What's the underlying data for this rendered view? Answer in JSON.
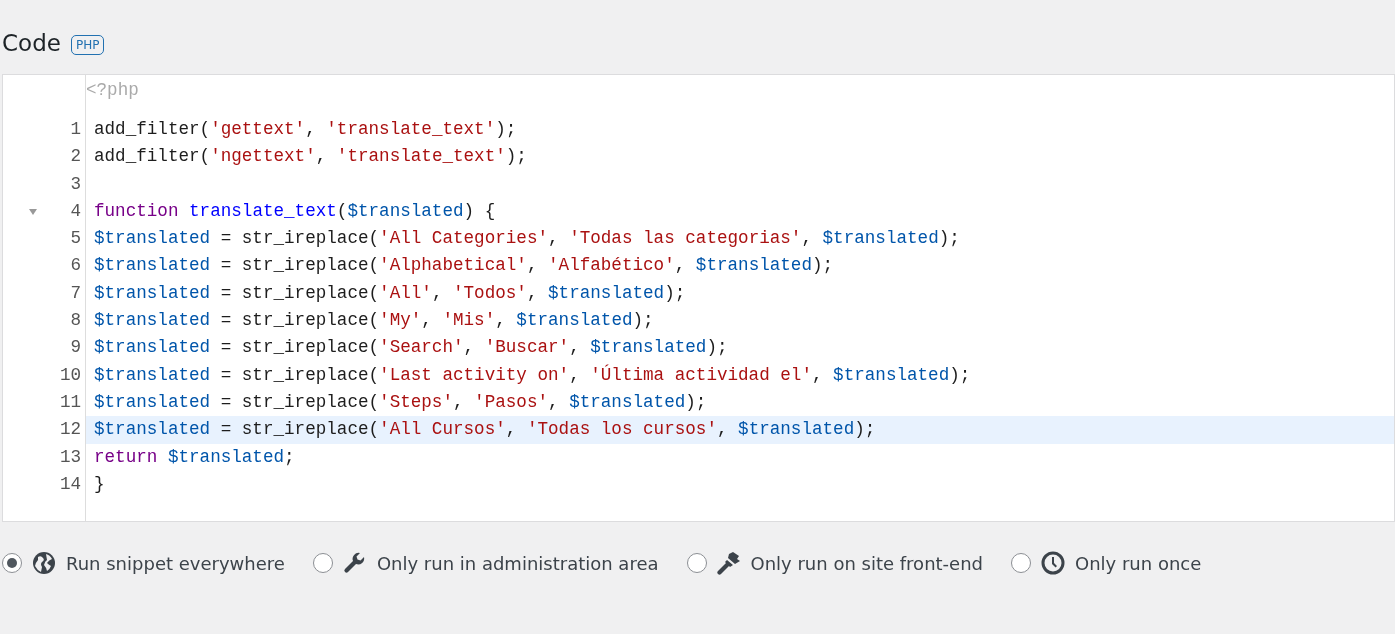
{
  "heading": {
    "title": "Code",
    "badge": "PHP"
  },
  "editor": {
    "preamble": "<?php",
    "lines": [
      {
        "number": "1",
        "active": false,
        "foldable": false,
        "tokens": [
          {
            "kind": "plain",
            "text": "add_filter("
          },
          {
            "kind": "string",
            "text": "'gettext'"
          },
          {
            "kind": "plain",
            "text": ", "
          },
          {
            "kind": "string",
            "text": "'translate_text'"
          },
          {
            "kind": "plain",
            "text": ");"
          }
        ]
      },
      {
        "number": "2",
        "active": false,
        "foldable": false,
        "tokens": [
          {
            "kind": "plain",
            "text": "add_filter("
          },
          {
            "kind": "string",
            "text": "'ngettext'"
          },
          {
            "kind": "plain",
            "text": ", "
          },
          {
            "kind": "string",
            "text": "'translate_text'"
          },
          {
            "kind": "plain",
            "text": ");"
          }
        ]
      },
      {
        "number": "3",
        "active": false,
        "foldable": false
      },
      {
        "number": "4",
        "active": false,
        "foldable": true,
        "tokens": [
          {
            "kind": "keyword",
            "text": "function "
          },
          {
            "kind": "def",
            "text": "translate_text"
          },
          {
            "kind": "plain",
            "text": "("
          },
          {
            "kind": "var",
            "text": "$translated"
          },
          {
            "kind": "plain",
            "text": ") {"
          }
        ]
      },
      {
        "number": "5",
        "active": false,
        "foldable": false,
        "tokens": [
          {
            "kind": "var",
            "text": "$translated"
          },
          {
            "kind": "plain",
            "text": " = str_ireplace("
          },
          {
            "kind": "string",
            "text": "'All Categories'"
          },
          {
            "kind": "plain",
            "text": ", "
          },
          {
            "kind": "string",
            "text": "'Todas las categorias'"
          },
          {
            "kind": "plain",
            "text": ", "
          },
          {
            "kind": "var",
            "text": "$translated"
          },
          {
            "kind": "plain",
            "text": ");"
          }
        ]
      },
      {
        "number": "6",
        "active": false,
        "foldable": false,
        "tokens": [
          {
            "kind": "var",
            "text": "$translated"
          },
          {
            "kind": "plain",
            "text": " = str_ireplace("
          },
          {
            "kind": "string",
            "text": "'Alphabetical'"
          },
          {
            "kind": "plain",
            "text": ", "
          },
          {
            "kind": "string",
            "text": "'Alfabético'"
          },
          {
            "kind": "plain",
            "text": ", "
          },
          {
            "kind": "var",
            "text": "$translated"
          },
          {
            "kind": "plain",
            "text": ");"
          }
        ]
      },
      {
        "number": "7",
        "active": false,
        "foldable": false,
        "tokens": [
          {
            "kind": "var",
            "text": "$translated"
          },
          {
            "kind": "plain",
            "text": " = str_ireplace("
          },
          {
            "kind": "string",
            "text": "'All'"
          },
          {
            "kind": "plain",
            "text": ", "
          },
          {
            "kind": "string",
            "text": "'Todos'"
          },
          {
            "kind": "plain",
            "text": ", "
          },
          {
            "kind": "var",
            "text": "$translated"
          },
          {
            "kind": "plain",
            "text": ");"
          }
        ]
      },
      {
        "number": "8",
        "active": false,
        "foldable": false,
        "tokens": [
          {
            "kind": "var",
            "text": "$translated"
          },
          {
            "kind": "plain",
            "text": " = str_ireplace("
          },
          {
            "kind": "string",
            "text": "'My'"
          },
          {
            "kind": "plain",
            "text": ", "
          },
          {
            "kind": "string",
            "text": "'Mis'"
          },
          {
            "kind": "plain",
            "text": ", "
          },
          {
            "kind": "var",
            "text": "$translated"
          },
          {
            "kind": "plain",
            "text": ");"
          }
        ]
      },
      {
        "number": "9",
        "active": false,
        "foldable": false,
        "tokens": [
          {
            "kind": "var",
            "text": "$translated"
          },
          {
            "kind": "plain",
            "text": " = str_ireplace("
          },
          {
            "kind": "string",
            "text": "'Search'"
          },
          {
            "kind": "plain",
            "text": ", "
          },
          {
            "kind": "string",
            "text": "'Buscar'"
          },
          {
            "kind": "plain",
            "text": ", "
          },
          {
            "kind": "var",
            "text": "$translated"
          },
          {
            "kind": "plain",
            "text": ");"
          }
        ]
      },
      {
        "number": "10",
        "active": false,
        "foldable": false,
        "tokens": [
          {
            "kind": "var",
            "text": "$translated"
          },
          {
            "kind": "plain",
            "text": " = str_ireplace("
          },
          {
            "kind": "string",
            "text": "'Last activity on'"
          },
          {
            "kind": "plain",
            "text": ", "
          },
          {
            "kind": "string",
            "text": "'Última actividad el'"
          },
          {
            "kind": "plain",
            "text": ", "
          },
          {
            "kind": "var",
            "text": "$translated"
          },
          {
            "kind": "plain",
            "text": ");"
          }
        ]
      },
      {
        "number": "11",
        "active": false,
        "foldable": false,
        "tokens": [
          {
            "kind": "var",
            "text": "$translated"
          },
          {
            "kind": "plain",
            "text": " = str_ireplace("
          },
          {
            "kind": "string",
            "text": "'Steps'"
          },
          {
            "kind": "plain",
            "text": ", "
          },
          {
            "kind": "string",
            "text": "'Pasos'"
          },
          {
            "kind": "plain",
            "text": ", "
          },
          {
            "kind": "var",
            "text": "$translated"
          },
          {
            "kind": "plain",
            "text": ");"
          }
        ]
      },
      {
        "number": "12",
        "active": true,
        "foldable": false,
        "tokens": [
          {
            "kind": "var",
            "text": "$translated"
          },
          {
            "kind": "plain",
            "text": " = str_ireplace("
          },
          {
            "kind": "string",
            "text": "'All Cursos'"
          },
          {
            "kind": "plain",
            "text": ", "
          },
          {
            "kind": "string",
            "text": "'Todas los cursos'"
          },
          {
            "kind": "plain",
            "text": ", "
          },
          {
            "kind": "var",
            "text": "$translated"
          },
          {
            "kind": "plain",
            "text": ");"
          }
        ]
      },
      {
        "number": "13",
        "active": false,
        "foldable": false,
        "tokens": [
          {
            "kind": "keyword",
            "text": "return "
          },
          {
            "kind": "var",
            "text": "$translated"
          },
          {
            "kind": "plain",
            "text": ";"
          }
        ]
      },
      {
        "number": "14",
        "active": false,
        "foldable": false,
        "tokens": [
          {
            "kind": "plain",
            "text": "}"
          }
        ]
      }
    ]
  },
  "scope_options": [
    {
      "label": "Run snippet everywhere",
      "selected": true
    },
    {
      "label": "Only run in administration area",
      "selected": false
    },
    {
      "label": "Only run on site front-end",
      "selected": false
    },
    {
      "label": "Only run once",
      "selected": false
    }
  ]
}
